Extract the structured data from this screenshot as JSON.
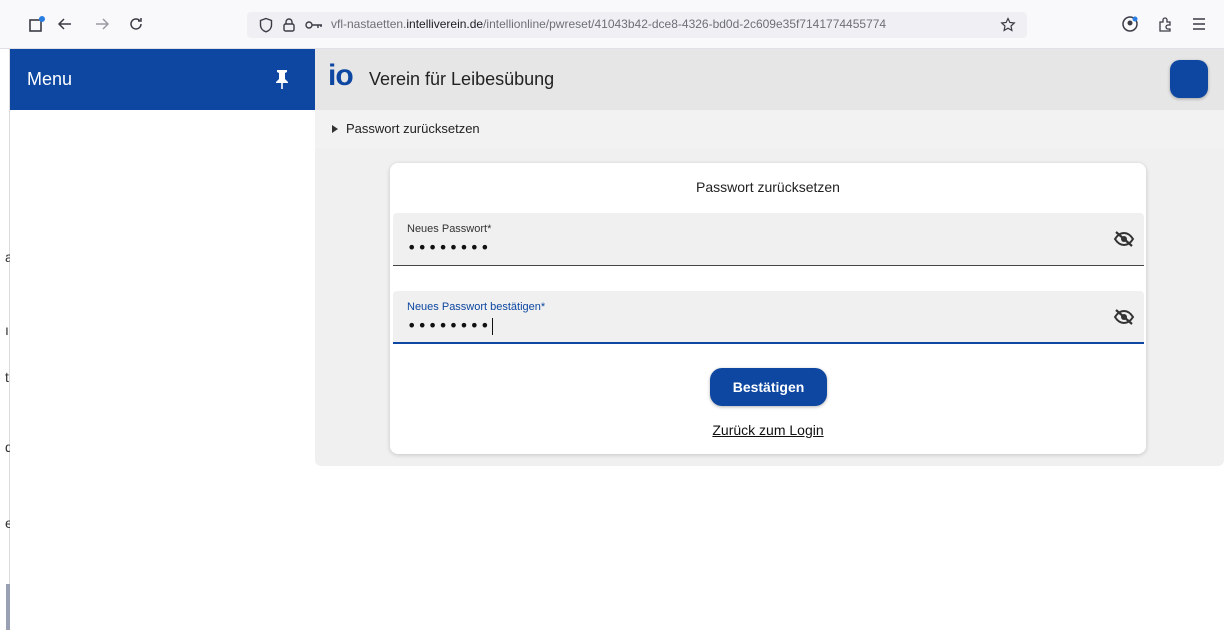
{
  "browser": {
    "url_prefix": "vfl-nastaetten.",
    "url_domain": "intelliverein.de",
    "url_path": "/intellionline/pwreset/41043b42-dce8-4326-bd0d-2c609e35f7141774455774"
  },
  "sidebar": {
    "title": "Menu",
    "strip_chars": [
      "a",
      "ı",
      "t",
      "d",
      "e"
    ]
  },
  "header": {
    "logo": "io",
    "title": "Verein für Leibesübung"
  },
  "breadcrumb": {
    "current": "Passwort zurücksetzen"
  },
  "form": {
    "title": "Passwort zurücksetzen",
    "new_password": {
      "label": "Neues Passwort*",
      "value": "••••••••"
    },
    "confirm_password": {
      "label": "Neues Passwort bestätigen*",
      "value": "••••••••"
    },
    "submit_label": "Bestätigen",
    "back_link": "Zurück zum Login"
  },
  "colors": {
    "primary": "#0d47a1",
    "header_bg": "#e6e6e6",
    "content_bg": "#f0f0f0"
  }
}
